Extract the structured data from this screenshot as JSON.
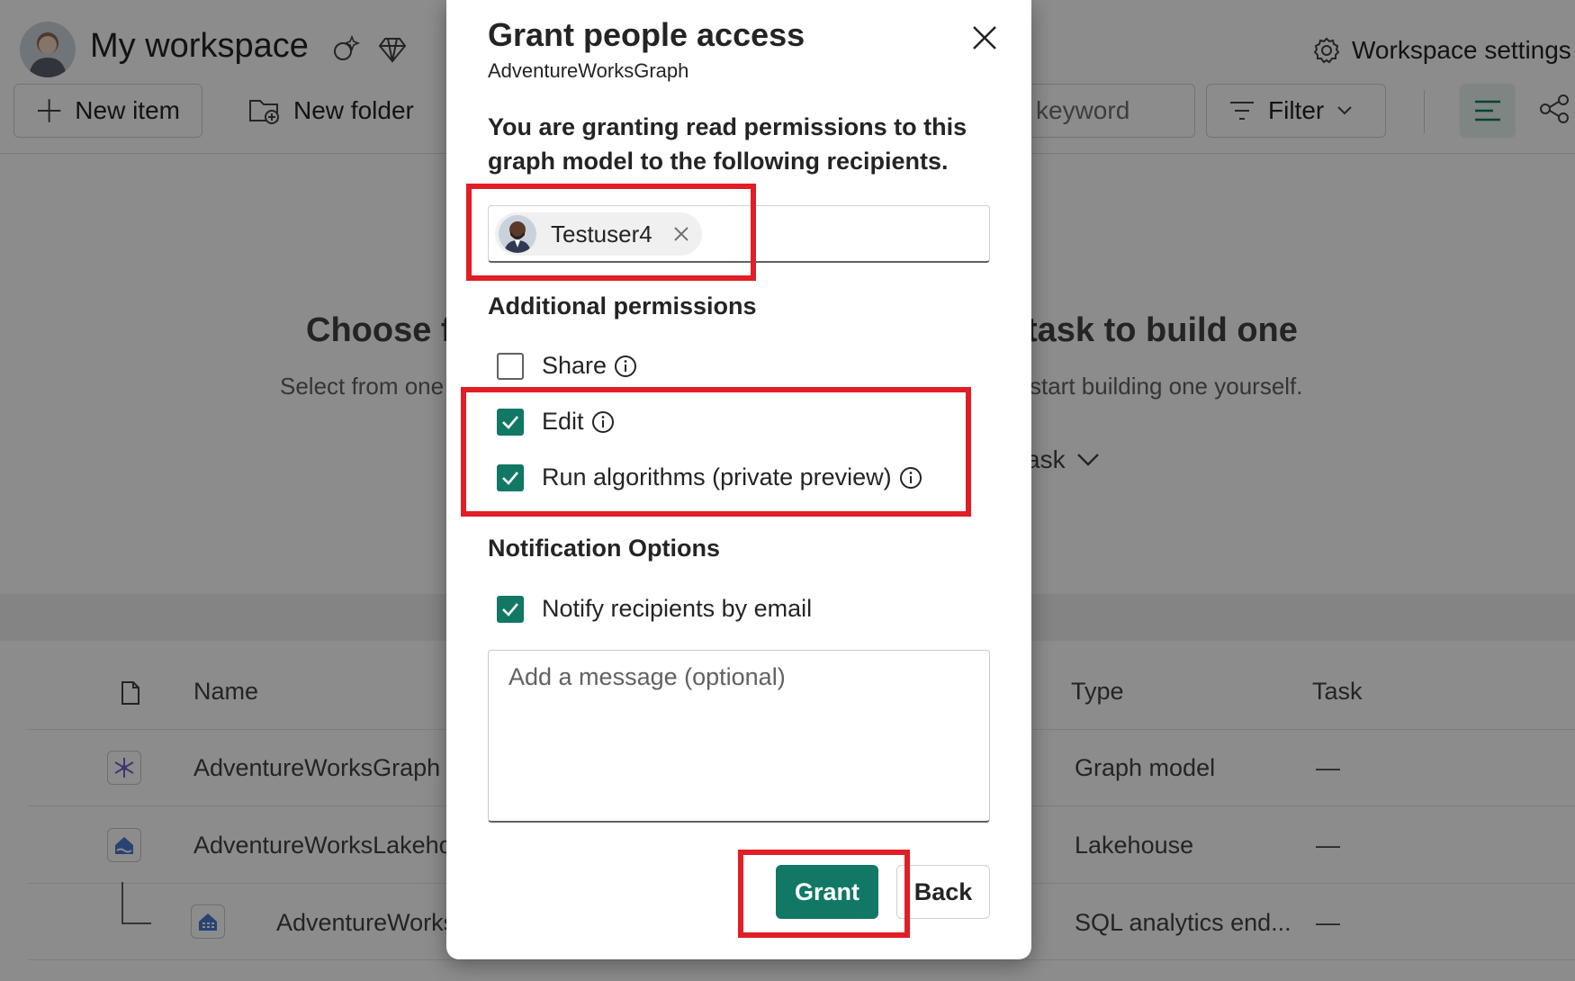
{
  "workspace": {
    "title": "My workspace",
    "settings_label": "Workspace settings"
  },
  "toolbar": {
    "new_item": "New item",
    "new_folder": "New folder",
    "search_placeholder": "keyword",
    "filter": "Filter"
  },
  "empty_state": {
    "title_left": "Choose f",
    "title_right": "task to build one",
    "subtitle_left": "Select from one",
    "subtitle_right": "start building one yourself.",
    "task_link": "ask"
  },
  "table": {
    "headers": {
      "name": "Name",
      "type": "Type",
      "task": "Task"
    },
    "rows": [
      {
        "name": "AdventureWorksGraph",
        "type": "Graph model",
        "task": "—",
        "icon": "graph-model-icon"
      },
      {
        "name": "AdventureWorksLakeho",
        "type": "Lakehouse",
        "task": "—",
        "icon": "lakehouse-icon"
      },
      {
        "name": "AdventureWorks",
        "type": "SQL analytics end...",
        "task": "—",
        "icon": "sql-endpoint-icon"
      }
    ]
  },
  "dialog": {
    "title": "Grant people access",
    "subtitle": "AdventureWorksGraph",
    "description": "You are granting read permissions to this graph model to the following recipients.",
    "recipient": "Testuser4",
    "additional_permissions_heading": "Additional permissions",
    "permissions": [
      {
        "label": "Share",
        "checked": false
      },
      {
        "label": "Edit",
        "checked": true
      },
      {
        "label": "Run algorithms (private preview)",
        "checked": true
      }
    ],
    "notification_heading": "Notification Options",
    "notify_label": "Notify recipients by email",
    "notify_checked": true,
    "message_placeholder": "Add a message (optional)",
    "grant_label": "Grant",
    "back_label": "Back"
  },
  "colors": {
    "accent": "#117865",
    "highlight": "#e01e26",
    "overlay": "rgba(0,0,0,0.45)"
  }
}
